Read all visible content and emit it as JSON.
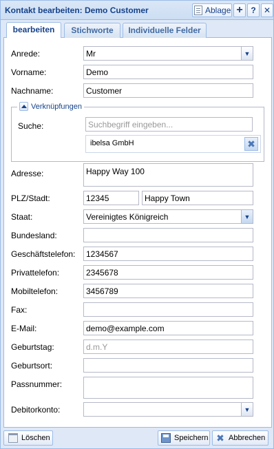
{
  "window": {
    "title": "Kontakt bearbeiten: Demo Customer",
    "toolbar": {
      "ablage_label": "Ablage",
      "add_icon": "plus-icon",
      "help_label": "?",
      "close_label": "✕"
    }
  },
  "tabs": [
    {
      "label": "bearbeiten",
      "active": true
    },
    {
      "label": "Stichworte",
      "active": false
    },
    {
      "label": "Individuelle Felder",
      "active": false
    }
  ],
  "form": {
    "anrede": {
      "label": "Anrede:",
      "value": "Mr"
    },
    "vorname": {
      "label": "Vorname:",
      "value": "Demo"
    },
    "nachname": {
      "label": "Nachname:",
      "value": "Customer"
    },
    "verknuepfungen": {
      "legend": "Verknüpfungen",
      "suche_label": "Suche:",
      "suche_placeholder": "Suchbegriff eingeben...",
      "linked_item": "ibelsa GmbH"
    },
    "adresse": {
      "label": "Adresse:",
      "value": "Happy Way 100"
    },
    "plz_stadt": {
      "label": "PLZ/Stadt:",
      "plz": "12345",
      "stadt": "Happy Town"
    },
    "staat": {
      "label": "Staat:",
      "value": "Vereinigtes Königreich"
    },
    "bundesland": {
      "label": "Bundesland:",
      "value": ""
    },
    "geschaeftstelefon": {
      "label": "Geschäftstelefon:",
      "value": "1234567"
    },
    "privattelefon": {
      "label": "Privattelefon:",
      "value": "2345678"
    },
    "mobiltelefon": {
      "label": "Mobiltelefon:",
      "value": "3456789"
    },
    "fax": {
      "label": "Fax:",
      "value": ""
    },
    "email": {
      "label": "E-Mail:",
      "value": "demo@example.com"
    },
    "geburtstag": {
      "label": "Geburtstag:",
      "placeholder": "d.m.Y"
    },
    "geburtsort": {
      "label": "Geburtsort:",
      "value": ""
    },
    "passnummer": {
      "label": "Passnummer:",
      "value": ""
    },
    "debitorkonto": {
      "label": "Debitorkonto:",
      "value": ""
    }
  },
  "footer": {
    "loeschen": "Löschen",
    "speichern": "Speichern",
    "abbrechen": "Abbrechen"
  },
  "colors": {
    "title_text": "#15428b",
    "border": "#99bbe8",
    "window_bg": "#dfe8f6"
  }
}
